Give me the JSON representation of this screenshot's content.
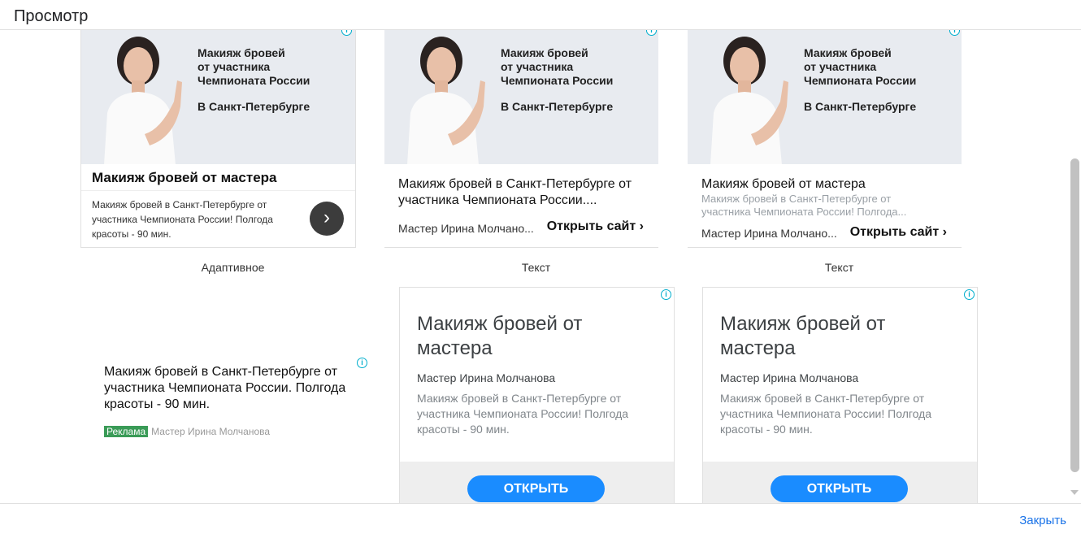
{
  "header": {
    "title": "Просмотр"
  },
  "banner": {
    "lines": [
      "Макияж бровей",
      "от участника",
      "Чемпионата России"
    ],
    "city": "В Санкт-Петербурге"
  },
  "info_symbol": "i",
  "card_adaptive": {
    "headline": "Макияж бровей от мастера",
    "description": "Макияж бровей в Санкт-Петербурге от участника Чемпионата России! Полгода красоты - 90 мин.",
    "arrow": "›",
    "label": "Адаптивное"
  },
  "card_text_1": {
    "headline": "Макияж бровей в Санкт-Петербурге от участника Чемпионата России....",
    "advertiser": "Мастер Ирина Молчано...",
    "open": "Открыть сайт ›",
    "label": "Текст"
  },
  "card_text_2": {
    "headline": "Макияж бровей от мастера",
    "description": "Макияж бровей в Санкт-Петербурге от участника Чемпионата России! Полгода...",
    "advertiser": "Мастер Ирина Молчано...",
    "open": "Открыть сайт ›",
    "label": "Текст"
  },
  "text_ad": {
    "headline": "Макияж бровей в Санкт-Петербурге от участника Чемпионата России. Полгода красоты - 90 мин.",
    "badge": "Реклама",
    "advertiser": "Мастер Ирина Молчанова"
  },
  "big_card": {
    "headline": "Макияж бровей от мастера",
    "advertiser": "Мастер Ирина Молчанова",
    "description": "Макияж бровей в Санкт-Петербурге от участника Чемпионата России! Полгода красоты - 90 мин.",
    "button": "ОТКРЫТЬ"
  },
  "footer": {
    "close": "Закрыть"
  },
  "colors": {
    "accent": "#1a73e8",
    "button_blue": "#1a8cff",
    "badge_green": "#3a9b57",
    "info": "#00aecd"
  }
}
